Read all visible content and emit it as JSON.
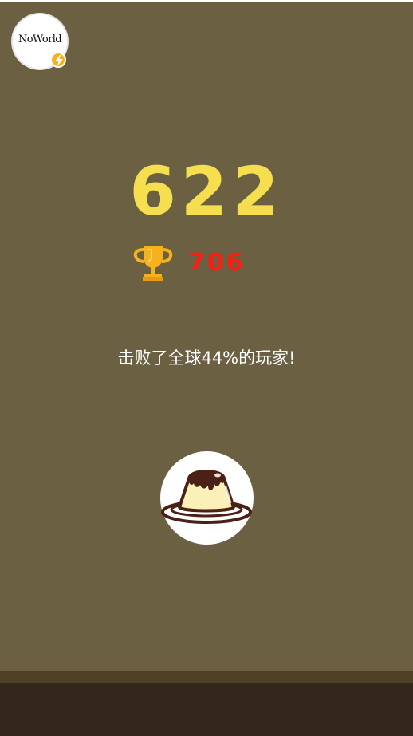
{
  "player": {
    "avatar_logo": "NoWorld",
    "badge_icon": "lightning-bolt-icon"
  },
  "game": {
    "score": "622",
    "best_score": "706",
    "rank_message": "击败了全球44%的玩家!",
    "action_icon": "pudding-icon"
  },
  "colors": {
    "background": "#6b6042",
    "score": "#f5df4f",
    "best_score": "#ff1a12",
    "trophy": "#f6b21e",
    "ground": "#33261a"
  }
}
